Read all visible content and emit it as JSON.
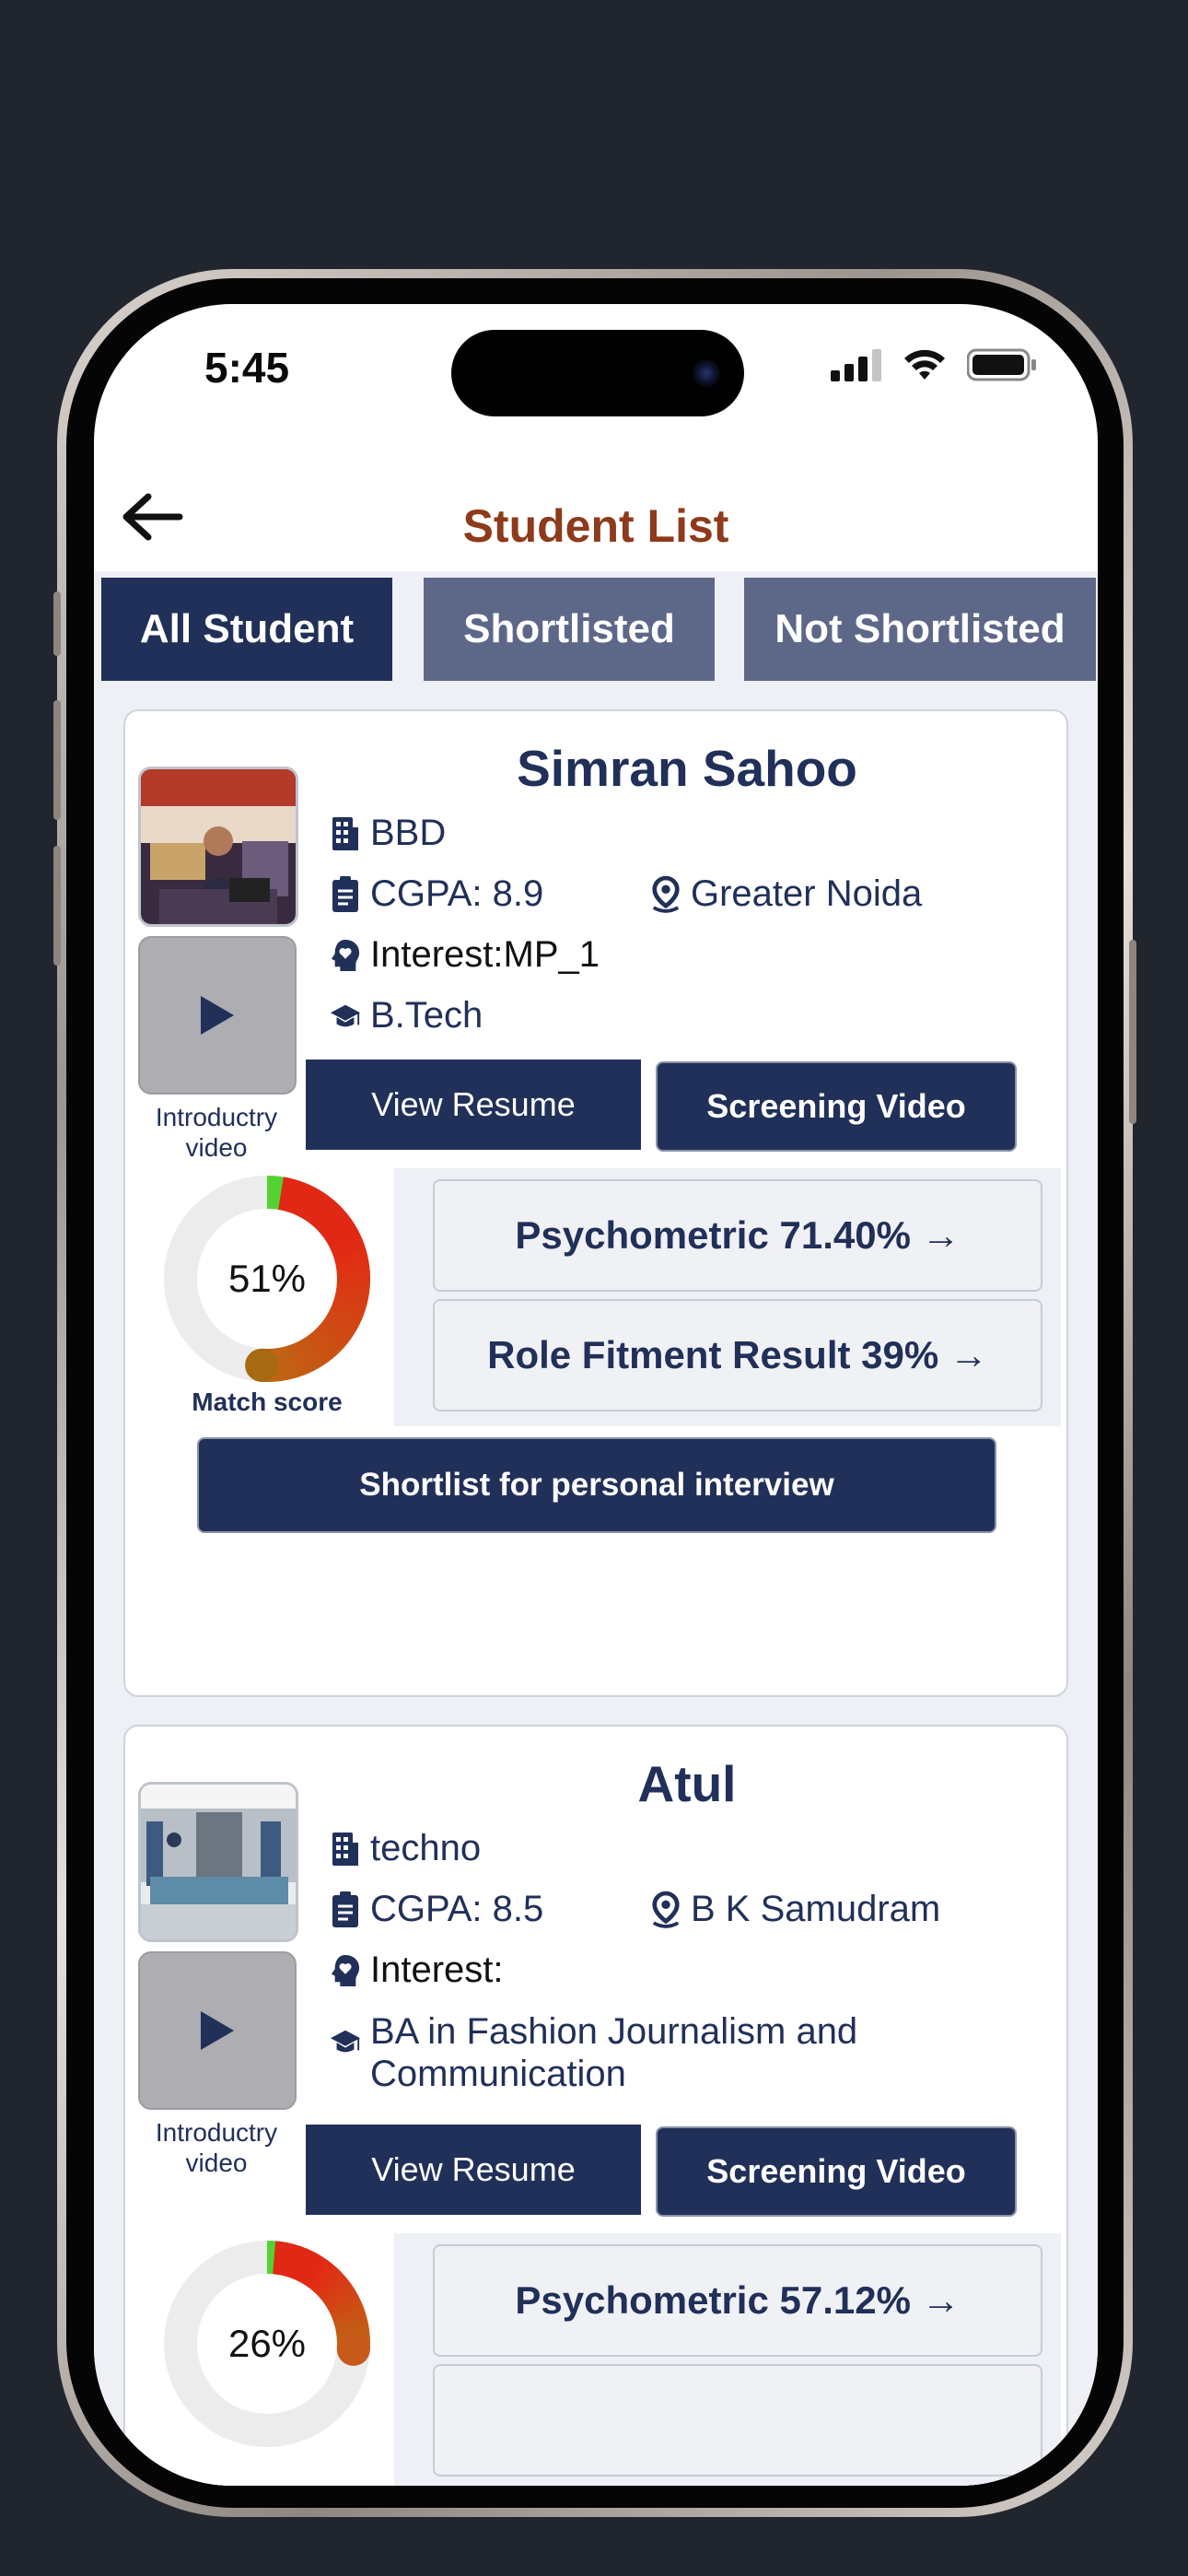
{
  "status_bar": {
    "time": "5:45"
  },
  "header": {
    "title": "Student List",
    "back_icon": "arrow-left-icon"
  },
  "tabs": [
    {
      "label": "All Student",
      "active": true
    },
    {
      "label": "Shortlisted",
      "active": false
    },
    {
      "label": "Not Shortlisted",
      "active": false
    }
  ],
  "students": [
    {
      "name": "Simran Sahoo",
      "college": "BBD",
      "cgpa": "CGPA: 8.9",
      "location": "Greater Noida",
      "interest": "Interest:MP_1",
      "degree": "B.Tech",
      "intro_label": "Introductry video",
      "view_resume": "View Resume",
      "screening_video": "Screening Video",
      "match_score_text": "51%",
      "match_score_value": 51,
      "match_score_label": "Match score",
      "psychometric": "Psychometric 71.40% →",
      "role_fitment": "Role Fitment Result 39% →",
      "shortlist": "Shortlist for personal interview"
    },
    {
      "name": "Atul",
      "college": "techno",
      "cgpa": "CGPA: 8.5",
      "location": "B K Samudram",
      "interest": "Interest:",
      "degree": "BA in Fashion Journalism and Communication",
      "intro_label": "Introductry video",
      "view_resume": "View Resume",
      "screening_video": "Screening Video",
      "match_score_text": "26%",
      "match_score_value": 26,
      "psychometric": "Psychometric 57.12% →"
    }
  ],
  "colors": {
    "primary": "#213059",
    "title": "#8e3a1c",
    "tab_inactive": "#5d6889"
  }
}
